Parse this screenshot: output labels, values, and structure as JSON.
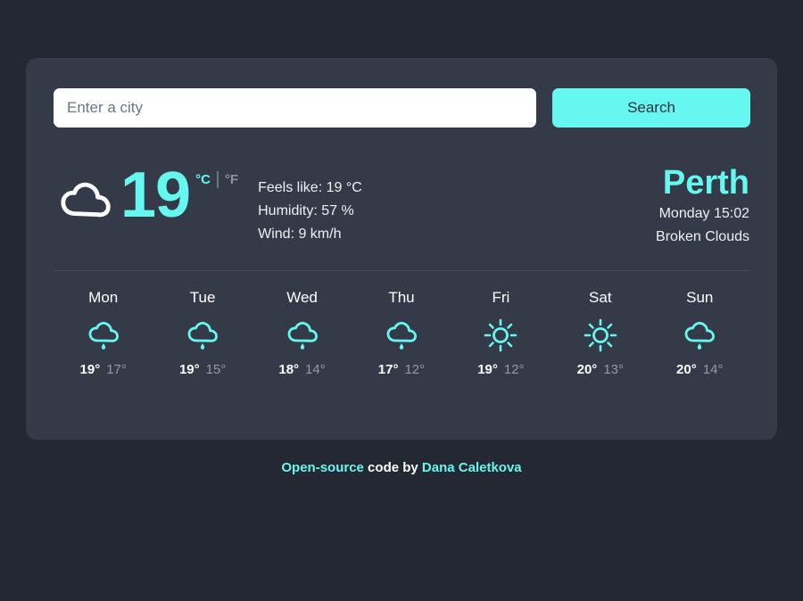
{
  "search": {
    "placeholder": "Enter a city",
    "value": "",
    "button_label": "Search"
  },
  "current": {
    "icon": "cloud-icon",
    "temperature": "19",
    "unit_celsius": "°C",
    "unit_fahrenheit": "°F",
    "active_unit": "celsius",
    "feels_like": "Feels like: 19 °C",
    "humidity": "Humidity: 57 %",
    "wind": "Wind: 9 km/h",
    "city": "Perth",
    "datetime": "Monday 15:02",
    "condition": "Broken Clouds"
  },
  "forecast": [
    {
      "day": "Mon",
      "icon": "rain-icon",
      "high": "19°",
      "low": "17°"
    },
    {
      "day": "Tue",
      "icon": "rain-icon",
      "high": "19°",
      "low": "15°"
    },
    {
      "day": "Wed",
      "icon": "rain-icon",
      "high": "18°",
      "low": "14°"
    },
    {
      "day": "Thu",
      "icon": "rain-icon",
      "high": "17°",
      "low": "12°"
    },
    {
      "day": "Fri",
      "icon": "sun-icon",
      "high": "19°",
      "low": "12°"
    },
    {
      "day": "Sat",
      "icon": "sun-icon",
      "high": "20°",
      "low": "13°"
    },
    {
      "day": "Sun",
      "icon": "rain-icon",
      "high": "20°",
      "low": "14°"
    }
  ],
  "footer": {
    "link1": "Open-source",
    "middle": " code by ",
    "link2": "Dana Caletkova"
  },
  "colors": {
    "page_background": "#242832",
    "card_background": "#343a47",
    "accent": "#66f7f0",
    "text_primary": "#ffffff",
    "text_muted": "#939aa7"
  }
}
